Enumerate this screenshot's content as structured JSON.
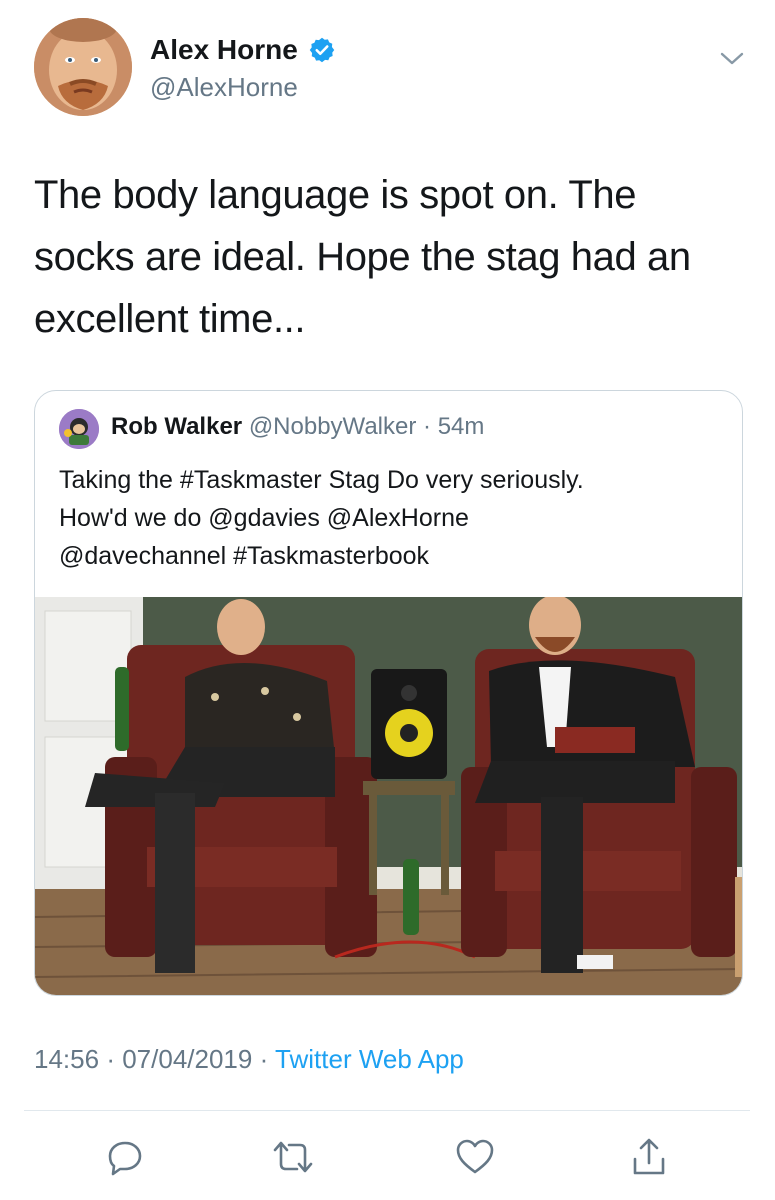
{
  "author": {
    "display_name": "Alex Horne",
    "handle": "@AlexHorne",
    "verified_icon": "verified-badge-icon"
  },
  "tweet": {
    "line1": "The body language is spot on. The",
    "line2": "socks are ideal. Hope the stag had an",
    "line3": "excellent time..."
  },
  "quoted": {
    "display_name": "Rob Walker",
    "handle": "@NobbyWalker",
    "dot": "·",
    "time": "54m",
    "line1": "Taking the #Taskmaster Stag Do very seriously.",
    "line2": "How'd we do @gdavies @AlexHorne",
    "line3": "@davechannel #Taskmasterbook"
  },
  "meta": {
    "time": "14:56",
    "sep1": "·",
    "date": "07/04/2019",
    "sep2": "·",
    "source": "Twitter Web App"
  },
  "actions": {
    "reply_icon": "reply-icon",
    "retweet_icon": "retweet-icon",
    "like_icon": "heart-icon",
    "share_icon": "share-icon"
  },
  "colors": {
    "link": "#1da1f2",
    "secondary_text": "#657786",
    "border": "#ccd6dd"
  }
}
